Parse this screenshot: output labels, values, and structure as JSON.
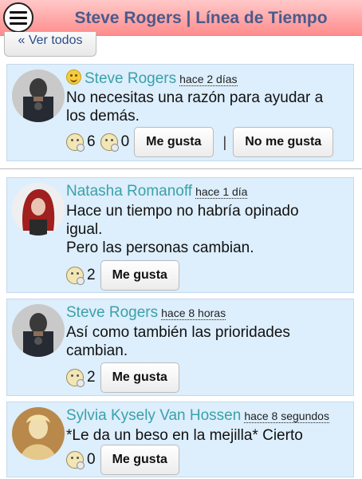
{
  "header": {
    "title": "Steve Rogers | Línea de Tiempo",
    "menu_icon": "hamburger-menu-icon"
  },
  "ver_todos": "« Ver todos",
  "posts": [
    {
      "author": "Steve Rogers",
      "time": "hace 2 días",
      "lines": [
        "No necesitas una razón para ayudar a",
        "los demás."
      ],
      "likes": "6",
      "dislikes": "0",
      "like_label": "Me gusta",
      "dislike_label": "No me gusta",
      "separator": "|"
    },
    {
      "author": "Natasha Romanoff",
      "time": "hace 1 día",
      "lines": [
        "Hace un tiempo no habría opinado",
        "igual.",
        "Pero las personas cambian."
      ],
      "likes": "2",
      "like_label": "Me gusta"
    },
    {
      "author": "Steve Rogers",
      "time": "hace 8 horas",
      "lines": [
        "Así como también las prioridades",
        "cambian."
      ],
      "likes": "2",
      "like_label": "Me gusta"
    },
    {
      "author": "Sylvia Kysely Van Hossen",
      "time": "hace 8 segundos",
      "lines": [
        "*Le da un beso en la mejilla* Cierto"
      ],
      "likes": "0",
      "like_label": "Me gusta"
    }
  ]
}
